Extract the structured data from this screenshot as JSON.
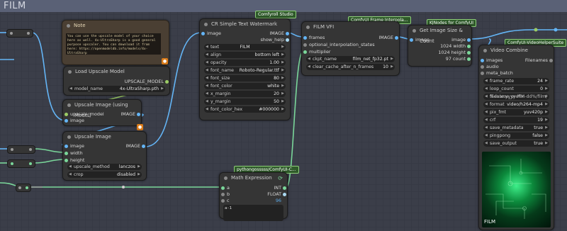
{
  "group": {
    "title": "FILM"
  },
  "badges": {
    "comfyroll": "Comfyroll Studio",
    "film_vfi": "ComfyUI Frame Interpola...",
    "kjnodes": "KJNodes for ComfyUI",
    "vhs": "ComfyUI-VideoHelperSuite",
    "pysss": "pythongosssss/ComfyUI-C..."
  },
  "note": {
    "title": "Note",
    "text": "You can use the upscale model of your choice here as well. 4x-UltraSharp is a good general purpose upscaler. You can download it from here: https://openmodeldb.info/models/4x-UltraSharp"
  },
  "load_upscale": {
    "title": "Load Upscale Model",
    "output": "UPSCALE_MODEL",
    "model_name_label": "model_name",
    "model_name_value": "4x-UltraSharp.pth"
  },
  "upscale_using_model": {
    "title": "Upscale Image (using Model)",
    "in1": "upscale_model",
    "in2": "image",
    "output": "IMAGE"
  },
  "upscale_image": {
    "title": "Upscale Image",
    "inputs": [
      "image",
      "width",
      "height"
    ],
    "output": "IMAGE",
    "method_label": "upscale_method",
    "method_value": "lanczos",
    "crop_label": "crop",
    "crop_value": "disabled"
  },
  "watermark": {
    "title": "CR Simple Text Watermark",
    "in1": "image",
    "out1": "IMAGE",
    "out2": "show_help",
    "widgets": [
      {
        "label": "text",
        "value": "FILM",
        "centered": true
      },
      {
        "label": "align",
        "value": "bottom left"
      },
      {
        "label": "opacity",
        "value": "1.00"
      },
      {
        "label": "font_name",
        "value": "Roboto-Regular.ttf"
      },
      {
        "label": "font_size",
        "value": "80"
      },
      {
        "label": "font_color",
        "value": "white"
      },
      {
        "label": "x_margin",
        "value": "20"
      },
      {
        "label": "y_margin",
        "value": "50"
      },
      {
        "label": "font_color_hex",
        "value": "#000000"
      }
    ]
  },
  "film": {
    "title": "FILM VFI",
    "inputs": [
      "frames",
      "optional_interpolation_states",
      "multiplier"
    ],
    "output": "IMAGE",
    "ckpt_label": "ckpt_name",
    "ckpt_value": "film_net_fp32.pt",
    "cache_label": "clear_cache_after_n_frames",
    "cache_value": "10"
  },
  "get_size": {
    "title": "Get Image Size & Count",
    "input": "image",
    "outputs": [
      "image",
      "1024 width",
      "1024 height",
      "97 count"
    ]
  },
  "video_combine": {
    "title": "Video Combine",
    "inputs": [
      "images",
      "audio",
      "meta_batch"
    ],
    "output": "Filenames",
    "widgets": [
      {
        "label": "frame_rate",
        "value": "24"
      },
      {
        "label": "loop_count",
        "value": "0"
      },
      {
        "label": "",
        "value": "%date:yyyy-MM-dd%/film/",
        "overlay": "filename_prefix"
      },
      {
        "label": "format",
        "value": "video/h264-mp4"
      },
      {
        "label": "pix_fmt",
        "value": "yuv420p"
      },
      {
        "label": "crf",
        "value": "19"
      },
      {
        "label": "save_metadata",
        "value": "true"
      },
      {
        "label": "pingpong",
        "value": "false"
      },
      {
        "label": "save_output",
        "value": "true"
      }
    ],
    "preview_caption": "FILM"
  },
  "math": {
    "title": "Math Expression",
    "inputs": [
      "a",
      "b",
      "c"
    ],
    "out1": "INT",
    "out2": "FLOAT",
    "value": "96",
    "expression": "a-1"
  },
  "colors": {
    "group_header": "#5a6176",
    "link_blue": "#64b5f6",
    "link_green": "#9ccc65",
    "badge_green": "#2f5a2a"
  }
}
